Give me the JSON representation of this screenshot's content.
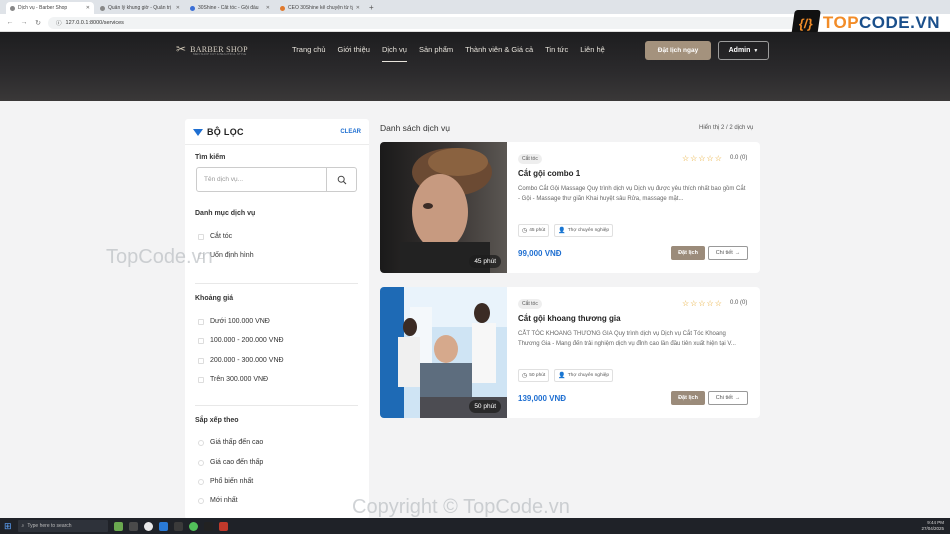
{
  "browser": {
    "tabs": [
      {
        "title": "Dịch vụ - Barber Shop",
        "active": true
      },
      {
        "title": "Quản lý khung giờ - Quản trị",
        "active": false
      },
      {
        "title": "30Shine - Cắt tóc - Gội đầu",
        "active": false
      },
      {
        "title": "CEO 30Shine kể chuyện từ tỷ",
        "active": false
      }
    ],
    "url": "127.0.0.1:8000/services"
  },
  "watermark_logo": {
    "prefix": "TOP",
    "suffix": "CODE.VN",
    "glyph": "{/}"
  },
  "site": {
    "brand": "BARBER SHOP",
    "brand_sub": "MEN SHOP CUT & BEAUTIFUL STYLE",
    "nav": [
      "Trang chủ",
      "Giới thiệu",
      "Dịch vụ",
      "Sản phẩm",
      "Thành viên & Giá cả",
      "Tin tức",
      "Liên hệ"
    ],
    "nav_active": "Dịch vụ",
    "book_button": "Đặt lịch ngay",
    "admin_button": "Admin"
  },
  "filter": {
    "title": "BỘ LỌC",
    "clear": "CLEAR",
    "search_label": "Tìm kiếm",
    "search_placeholder": "Tên dịch vụ...",
    "category_label": "Danh mục dịch vụ",
    "categories": [
      "Cắt tóc",
      "Uốn định hình"
    ],
    "price_label": "Khoảng giá",
    "prices": [
      "Dưới 100.000 VNĐ",
      "100.000 - 200.000 VNĐ",
      "200.000 - 300.000 VNĐ",
      "Trên 300.000 VNĐ"
    ],
    "sort_label": "Sắp xếp theo",
    "sorts": [
      "Giá thấp đến cao",
      "Giá cao đến thấp",
      "Phổ biến nhất",
      "Mới nhất"
    ]
  },
  "list": {
    "title": "Danh sách dịch vụ",
    "count": "Hiển thị 2 / 2 dịch vụ",
    "services": [
      {
        "category": "Cắt tóc",
        "name": "Cắt gội combo 1",
        "description": "Combo Cắt Gội Massage Quy trình dịch vụ Dịch vụ được yêu thích nhất bao gồm Cắt - Gội - Massage thư giãn Khai huyệt sâu Rửa, massage mặt...",
        "duration": "45 phút",
        "stylist": "Thợ chuyên nghiệp",
        "price": "99,000 VNĐ",
        "rating": "0.0 (0)",
        "rating_value": 0,
        "book": "Đặt lịch",
        "detail": "Chi tiết"
      },
      {
        "category": "Cắt tóc",
        "name": "Cắt gội khoang thương gia",
        "description": "CẮT TÓC KHOANG THƯƠNG GIA Quy trình dịch vụ Dịch vụ Cắt Tóc Khoang Thương Gia - Mang đến trải nghiệm dịch vụ đỉnh cao lần đầu tiên xuất hiện tại V...",
        "duration": "50 phút",
        "stylist": "Thợ chuyên nghiệp",
        "price": "139,000 VNĐ",
        "rating": "0.0 (0)",
        "rating_value": 0,
        "book": "Đặt lịch",
        "detail": "Chi tiết"
      }
    ]
  },
  "watermark_text": "TopCode.vn",
  "watermark_copyright": "Copyright © TopCode.vn",
  "taskbar": {
    "search_placeholder": "Type here to search",
    "time": "9:44 PM",
    "date": "27/04/2025"
  },
  "colors": {
    "accent": "#1f6fd1",
    "brand": "#a4927d",
    "star": "#e4a11b"
  }
}
